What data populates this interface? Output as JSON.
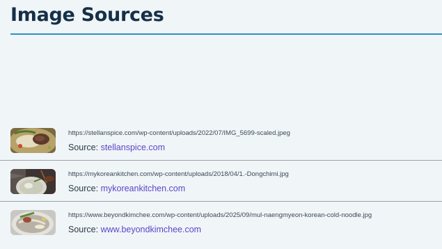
{
  "page": {
    "title": "Image Sources"
  },
  "colors": {
    "title": "#153047",
    "rule": "#2d8fc7",
    "link": "#5a46c8",
    "divider": "#9aa3a8",
    "background": "#f0f5f8"
  },
  "sources": [
    {
      "url": "https://stellanspice.com/wp-content/uploads/2022/07/IMG_5699-scaled.jpeg",
      "label": "Source:",
      "domain": "stellanspice.com",
      "thumbnail": "noodle-dish-photo"
    },
    {
      "url": "https://mykoreankitchen.com/wp-content/uploads/2018/04/1.-Dongchimi.jpg",
      "label": "Source:",
      "domain": "mykoreankitchen.com",
      "thumbnail": "dongchimi-bowl-photo"
    },
    {
      "url": "https://www.beyondkimchee.com/wp-content/uploads/2025/09/mul-naengmyeon-korean-cold-noodle.jpg",
      "label": "Source:",
      "domain": "www.beyondkimchee.com",
      "thumbnail": "cold-noodle-bowl-photo"
    }
  ]
}
